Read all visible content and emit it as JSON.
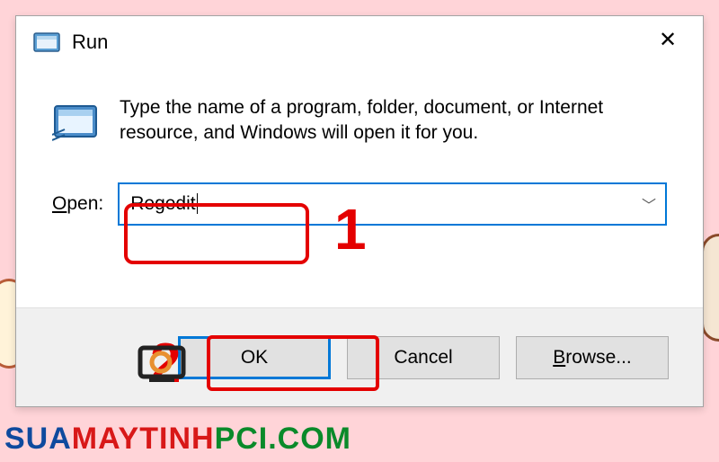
{
  "dialog": {
    "title": "Run",
    "instruction": "Type the name of a program, folder, document, or Internet resource, and Windows will open it for you.",
    "open_label_underlined": "O",
    "open_label_rest": "pen:",
    "input_value": "Regedit",
    "close_symbol": "✕",
    "dropdown_symbol": "﹀"
  },
  "buttons": {
    "ok": "OK",
    "cancel": "Cancel",
    "browse_underlined": "B",
    "browse_rest": "rowse..."
  },
  "annotations": {
    "step1": "1",
    "step2": "2"
  },
  "watermark": {
    "part_blue": "SUA",
    "part_red": "MAYTINH",
    "part_green": "PCI.COM"
  }
}
